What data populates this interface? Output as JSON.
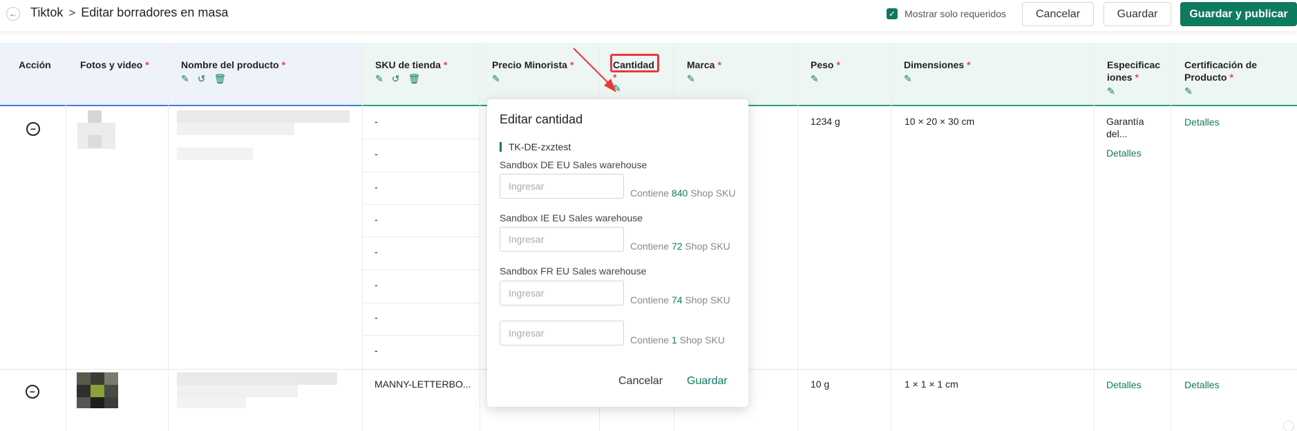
{
  "topbar": {
    "back_icon": "arrow-left-icon",
    "app": "Tiktok",
    "separator": ">",
    "page_title": "Editar borradores en masa",
    "only_required_label": "Mostrar solo requeridos",
    "only_required_checked": true,
    "cancel_label": "Cancelar",
    "save_label": "Guardar",
    "save_publish_label": "Guardar y publicar"
  },
  "columns": {
    "action": "Acción",
    "photos": "Fotos y video",
    "name": "Nombre del producto",
    "sku": "SKU de tienda",
    "price": "Precio Minorista",
    "quantity": "Cantidad",
    "brand": "Marca",
    "weight": "Peso",
    "dimensions": "Dimensiones",
    "specs_line1": "Especificac",
    "specs_line2": "iones",
    "cert_line1": "Certificación de",
    "cert_line2": "Producto",
    "required_mark": "*"
  },
  "rows": [
    {
      "action_icon": "minus-circle-icon",
      "sku_values": [
        "-",
        "-",
        "-",
        "-",
        "-",
        "-",
        "-",
        "-"
      ],
      "weight": "1234 g",
      "dimensions": "10 × 20 × 30 cm",
      "specs_text_1": "Garantía",
      "specs_text_2": "del...",
      "specs_link": "Detalles",
      "cert_link": "Detalles"
    },
    {
      "action_icon": "minus-circle-icon",
      "sku": "MANNY-LETTERBO...",
      "weight": "10 g",
      "dimensions": "1 × 1 × 1 cm",
      "specs_link": "Detalles",
      "cert_link": "Detalles"
    }
  ],
  "popup": {
    "title": "Editar cantidad",
    "shop": "TK-DE-zxztest",
    "placeholder": "Ingresar",
    "contains_prefix": "Contiene",
    "contains_suffix": "Shop SKU",
    "warehouses": [
      {
        "label": "Sandbox DE EU Sales warehouse",
        "count": "840"
      },
      {
        "label": "Sandbox IE EU Sales warehouse",
        "count": "72"
      },
      {
        "label": "Sandbox FR EU Sales warehouse",
        "count": "74"
      },
      {
        "label": "",
        "count": "1"
      }
    ],
    "cancel_label": "Cancelar",
    "save_label": "Guardar"
  },
  "colors": {
    "accent": "#0e7a5f",
    "required": "#e64545",
    "annotation": "#e8383d"
  }
}
